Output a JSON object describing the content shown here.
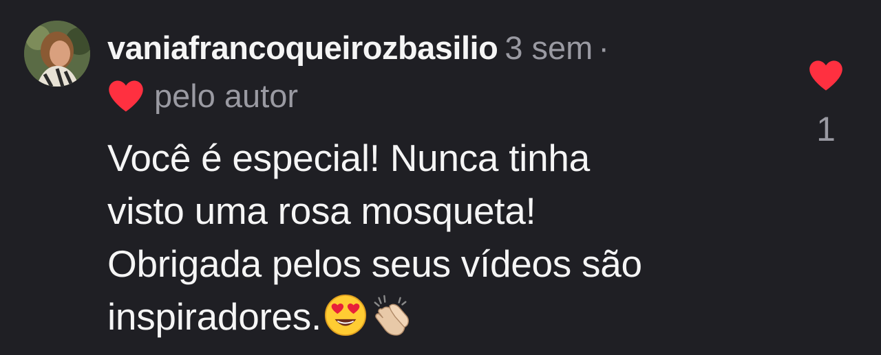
{
  "comment": {
    "username": "vaniafrancoqueirozbasilio",
    "time": "3 sem",
    "separator": "·",
    "liked_by_author_label": "pelo autor",
    "text_lines": [
      "Você é especial! Nunca tinha",
      "visto uma rosa mosqueta!",
      "Obrigada pelos seus vídeos são",
      "inspiradores."
    ],
    "emojis": [
      "heart-eyes-emoji",
      "clapping-hands-emoji"
    ],
    "like_count": "1"
  },
  "colors": {
    "background": "#1f1f24",
    "heart": "#ff3040",
    "muted_text": "#9a9aa2",
    "primary_text": "#f5f5f5"
  }
}
